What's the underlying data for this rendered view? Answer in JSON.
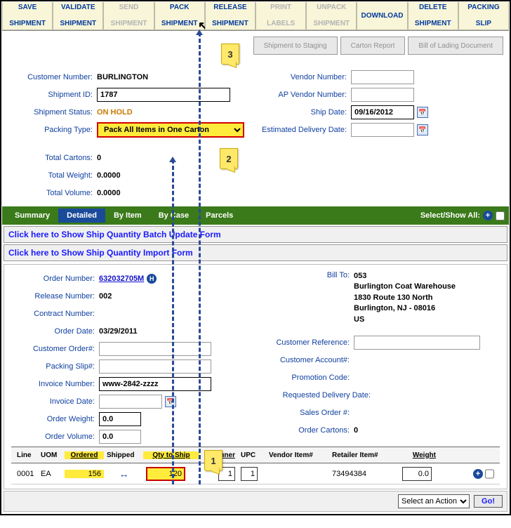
{
  "toolbar": [
    {
      "label1": "SAVE",
      "label2": "SHIPMENT",
      "enabled": true
    },
    {
      "label1": "VALIDATE",
      "label2": "SHIPMENT",
      "enabled": true
    },
    {
      "label1": "SEND",
      "label2": "SHIPMENT",
      "enabled": false
    },
    {
      "label1": "PACK",
      "label2": "SHIPMENT",
      "enabled": true,
      "cursor": true
    },
    {
      "label1": "RELEASE",
      "label2": "SHIPMENT",
      "enabled": true
    },
    {
      "label1": "PRINT",
      "label2": "LABELS",
      "enabled": false
    },
    {
      "label1": "UNPACK",
      "label2": "SHIPMENT",
      "enabled": false
    },
    {
      "label1": "DOWNLOAD",
      "label2": "",
      "enabled": true
    },
    {
      "label1": "DELETE",
      "label2": "SHIPMENT",
      "enabled": true
    },
    {
      "label1": "PACKING",
      "label2": "SLIP",
      "enabled": true
    }
  ],
  "secondary": [
    "Shipment to Staging",
    "Carton Report",
    "Bill of Lading Document"
  ],
  "callouts": {
    "c1": "1",
    "c2": "2",
    "c3": "3"
  },
  "left": {
    "customer_number_lbl": "Customer Number:",
    "customer_number": "BURLINGTON",
    "shipment_id_lbl": "Shipment ID:",
    "shipment_id": "1787",
    "shipment_status_lbl": "Shipment Status:",
    "shipment_status": "ON HOLD",
    "packing_type_lbl": "Packing Type:",
    "packing_type": "Pack All Items in One Carton",
    "total_cartons_lbl": "Total Cartons:",
    "total_cartons": "0",
    "total_weight_lbl": "Total Weight:",
    "total_weight": "0.0000",
    "total_volume_lbl": "Total Volume:",
    "total_volume": "0.0000"
  },
  "right": {
    "vendor_number_lbl": "Vendor Number:",
    "ap_vendor_lbl": "AP Vendor Number:",
    "ship_date_lbl": "Ship Date:",
    "ship_date": "09/16/2012",
    "est_delivery_lbl": "Estimated Delivery Date:"
  },
  "tabs": {
    "summary": "Summary",
    "detailed": "Detailed",
    "byitem": "By Item",
    "bycase": "By Case",
    "parcels": "Parcels",
    "selshow": "Select/Show All:"
  },
  "linkbars": {
    "batch": "Click here to Show Ship Quantity Batch Update Form",
    "import": "Click here to Show Ship Quantity Import Form"
  },
  "order": {
    "order_number_lbl": "Order Number:",
    "order_number": "632032705M",
    "release_number_lbl": "Release Number:",
    "release_number": "002",
    "contract_number_lbl": "Contract Number:",
    "order_date_lbl": "Order Date:",
    "order_date": "03/29/2011",
    "customer_order_lbl": "Customer Order#:",
    "packing_slip_lbl": "Packing Slip#:",
    "invoice_number_lbl": "Invoice Number:",
    "invoice_number": "www-2842-zzzz",
    "invoice_date_lbl": "Invoice Date:",
    "order_weight_lbl": "Order Weight:",
    "order_weight": "0.0",
    "order_volume_lbl": "Order Volume:",
    "order_volume": "0.0"
  },
  "orderright": {
    "bill_to_lbl": "Bill To:",
    "bill_to_code": "053",
    "bill_to_name": "Burlington Coat Warehouse",
    "bill_to_addr1": "1830 Route 130 North",
    "bill_to_addr2": "Burlington, NJ - 08016",
    "bill_to_country": "US",
    "cust_ref_lbl": "Customer Reference:",
    "cust_acct_lbl": "Customer Account#:",
    "promo_lbl": "Promotion Code:",
    "req_deliv_lbl": "Requested Delivery Date:",
    "sales_order_lbl": "Sales Order #:",
    "order_cartons_lbl": "Order Cartons:",
    "order_cartons": "0"
  },
  "headers": {
    "line": "Line",
    "uom": "UOM",
    "ordered": "Ordered",
    "shipped": "Shipped",
    "qty": "Qty to Ship",
    "inner": "Inner",
    "upc": "UPC",
    "vendor": "Vendor Item#",
    "retailer": "Retailer Item#",
    "weight": "Weight"
  },
  "rowdata": {
    "line": "0001",
    "uom": "EA",
    "ordered": "156",
    "qty": "120",
    "inner1": "1",
    "inner2": "1",
    "retailer": "73494384",
    "weight": "0.0"
  },
  "footer": {
    "selaction": "Select an Action",
    "go": "Go!"
  }
}
